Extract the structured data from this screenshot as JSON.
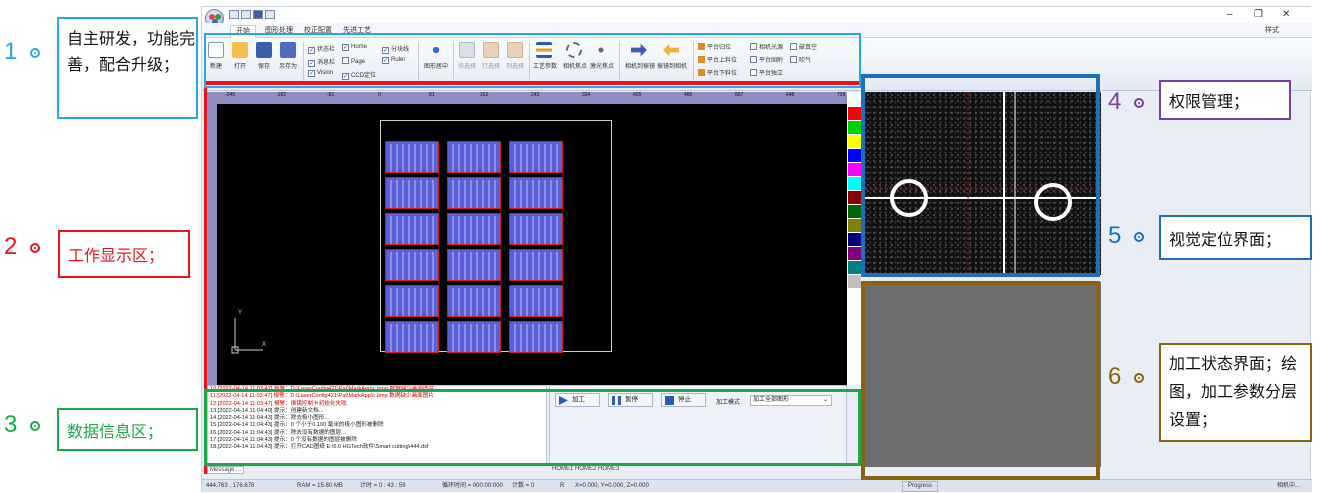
{
  "app": {
    "title_right": "样式",
    "tabs": [
      "开始",
      "图形处理",
      "校正配置",
      "先进工艺"
    ],
    "ribbon": {
      "file_buttons": [
        "新建",
        "打开",
        "保存",
        "另存为"
      ],
      "view_checks": [
        {
          "label": "状态栏",
          "checked": true
        },
        {
          "label": "Home",
          "checked": true
        },
        {
          "label": "分块线",
          "checked": true
        },
        {
          "label": "消息栏",
          "checked": true
        },
        {
          "label": "Page",
          "checked": false
        },
        {
          "label": "Ruler",
          "checked": true
        },
        {
          "label": "Vision",
          "checked": true
        },
        {
          "label": "CCD定位",
          "checked": true
        }
      ],
      "center_button": "图形居中",
      "select_buttons": [
        "块选择",
        "行选择",
        "列选择"
      ],
      "process_buttons": [
        "工艺参数",
        "相机焦点",
        "激光焦点",
        "相机到振镜",
        "振镜到相机"
      ],
      "platform_buttons": [
        "平台归位",
        "平台上料位",
        "平台下料位"
      ],
      "platform_checks": [
        {
          "label": "相机光源",
          "checked": false
        },
        {
          "label": "破真空",
          "checked": false
        },
        {
          "label": "平台固附",
          "checked": false
        },
        {
          "label": "吹气",
          "checked": false
        },
        {
          "label": "平台独立",
          "checked": false
        }
      ]
    },
    "ruler_labels": [
      "-245",
      "-162",
      "-81",
      "0",
      "81",
      "162",
      "243",
      "324",
      "405",
      "486",
      "567",
      "648",
      "729"
    ],
    "palette": [
      "#ffffff",
      "#ff0000",
      "#00d000",
      "#ffff00",
      "#0000ff",
      "#ff00ff",
      "#00ffff",
      "#8b0000",
      "#006400",
      "#808000",
      "#000080",
      "#800080",
      "#008080",
      "#c0c0c0"
    ],
    "axis": {
      "y": "Y",
      "x": "X"
    },
    "log_lines": [
      {
        "text": "10.[2022-04-14 11:03:47] 报警：D:\\LaserConfig421\\Pat\\MarkApp\\c.bmp 数据缺少画面图片",
        "color": "#d00000"
      },
      {
        "text": "11.[2022-04-14 11:03:47] 报警：D:\\LaserConfig421\\Pat\\MarkApp\\c.bmp 数据缺少画面图片",
        "color": "#d00000"
      },
      {
        "text": "12.[2022-04-14 11:03:47] 报警：振镜控制卡初始化失败.",
        "color": "#d00000"
      },
      {
        "text": "13.[2022-04-14 11:04:40] 提示：创建新文档...",
        "color": "#222"
      },
      {
        "text": "14.[2022-04-14 11:04:43] 提示：除去极小图形...",
        "color": "#222"
      },
      {
        "text": "15.[2022-04-14 11:04:43] 提示：0 个小于0.100 毫米的极小图形被删除",
        "color": "#222"
      },
      {
        "text": "16.[2022-04-14 11:04:43] 提示：除去没有数据的图层...",
        "color": "#222"
      },
      {
        "text": "17.[2022-04-14 11:04:43] 提示：0 个没有数据的图层被删除",
        "color": "#222"
      },
      {
        "text": "18.[2022-04-14 11:04:43] 提示：打开CAD图纸 E:\\6.0 HGTech软件\\Smart cutting\\444.dxf",
        "color": "#222"
      }
    ],
    "control": {
      "start": "加工",
      "pause": "暂停",
      "stop": "停止",
      "mode_label": "加工模式",
      "mode_value": "加工全部图形"
    },
    "bottom_tabs": {
      "message": "Message ...",
      "homes": "HOME1 HOME2 HOME3"
    },
    "status": {
      "coords": "444.763 , 176.678",
      "ram": "RAM = 15.80 MB",
      "timer": "计时 = 0 : 43 : 59",
      "cycle": "循环时间 = 000:00:000",
      "count": "计数 = 0",
      "r": "R",
      "xyz": "X=0.000, Y=0.000, Z=0.000",
      "progress": "Progress",
      "camera": "相机中..."
    }
  },
  "annotations": [
    {
      "num": "1",
      "text": "自主研发，功能完善，配合升级；",
      "color": "#29a8e0"
    },
    {
      "num": "2",
      "text": "工作显示区；",
      "color": "#e8141b"
    },
    {
      "num": "3",
      "text": "数据信息区；",
      "color": "#1aa84a"
    },
    {
      "num": "4",
      "text": "权限管理；",
      "color": "#7b3fa0"
    },
    {
      "num": "5",
      "text": "视觉定位界面；",
      "color": "#1e6fb8"
    },
    {
      "num": "6",
      "text": "加工状态界面；绘图，加工参数分层设置；",
      "color": "#8a6310"
    }
  ]
}
